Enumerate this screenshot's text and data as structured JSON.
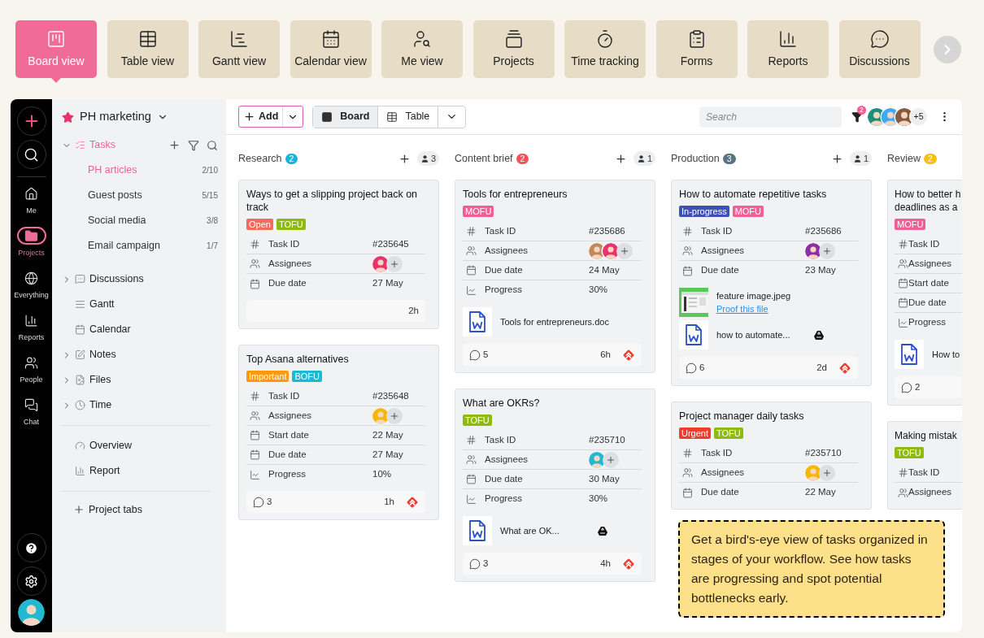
{
  "feature_tabs": [
    {
      "label": "Board view",
      "selected": true
    },
    {
      "label": "Table view",
      "selected": false
    },
    {
      "label": "Gantt view",
      "selected": false
    },
    {
      "label": "Calendar view",
      "selected": false
    },
    {
      "label": "Me view",
      "selected": false
    },
    {
      "label": "Projects",
      "selected": false
    },
    {
      "label": "Time tracking",
      "selected": false
    },
    {
      "label": "Forms",
      "selected": false
    },
    {
      "label": "Reports",
      "selected": false
    },
    {
      "label": "Discussions",
      "selected": false
    }
  ],
  "rail": {
    "items": [
      {
        "label": "Me",
        "selected": false
      },
      {
        "label": "Projects",
        "selected": true
      },
      {
        "label": "Everything",
        "selected": false
      },
      {
        "label": "Reports",
        "selected": false
      },
      {
        "label": "People",
        "selected": false
      },
      {
        "label": "Chat",
        "selected": false
      }
    ],
    "user_avatar": {
      "color": "#22b8cf"
    }
  },
  "sidebar": {
    "project": "PH marketing",
    "groups": [
      [
        {
          "label": "Tasks",
          "kind": "folder",
          "expanded": true,
          "selected": true,
          "children": [
            {
              "label": "PH articles",
              "count": "2/10",
              "selected": true
            },
            {
              "label": "Guest posts",
              "count": "5/15",
              "selected": false
            },
            {
              "label": "Social media",
              "count": "3/8",
              "selected": false
            },
            {
              "label": "Email campaign",
              "count": "1/7",
              "selected": false
            }
          ]
        },
        {
          "label": "Discussions",
          "kind": "folder",
          "expanded": false,
          "selected": false
        },
        {
          "label": "Gantt",
          "kind": "page",
          "selected": false
        },
        {
          "label": "Calendar",
          "kind": "page",
          "selected": false
        },
        {
          "label": "Notes",
          "kind": "folder",
          "expanded": false,
          "selected": false
        },
        {
          "label": "Files",
          "kind": "folder",
          "expanded": false,
          "selected": false
        },
        {
          "label": "Time",
          "kind": "folder",
          "expanded": false,
          "selected": false
        }
      ],
      [
        {
          "label": "Overview",
          "kind": "page",
          "selected": false
        },
        {
          "label": "Report",
          "kind": "page",
          "selected": false
        }
      ]
    ],
    "add_tab": "Project tabs"
  },
  "toolbar": {
    "add": "Add",
    "views": [
      {
        "label": "Board",
        "selected": true
      },
      {
        "label": "Table",
        "selected": false
      }
    ],
    "search_placeholder": "Search",
    "filter_count": "2",
    "members": [
      {
        "color": "#1e8f7a"
      },
      {
        "color": "#3fa9f5"
      },
      {
        "color": "#8a5a3c"
      }
    ],
    "more_members": "+5"
  },
  "columns": [
    {
      "name": "Research",
      "count": "2",
      "color": "#18b4d8",
      "people": "3",
      "cards": [
        {
          "title": "Ways to get a slipping project back on track",
          "tags": [
            {
              "label": "Open",
              "color": "#f26b5b"
            },
            {
              "label": "TOFU",
              "color": "#8fba0f"
            }
          ],
          "fields": [
            {
              "kind": "id",
              "label": "Task ID",
              "value": "#235645"
            },
            {
              "kind": "assignees",
              "label": "Assignees",
              "avatars": [
                {
                  "color": "#e8336d"
                }
              ]
            },
            {
              "kind": "date",
              "label": "Due date",
              "value": "27 May"
            }
          ],
          "footer": {
            "time": "2h",
            "priority": false
          }
        },
        {
          "title": "Top Asana alternatives",
          "tags": [
            {
              "label": "Important",
              "color": "#ff9a0e"
            },
            {
              "label": "BOFU",
              "color": "#1cb8d8"
            }
          ],
          "fields": [
            {
              "kind": "id",
              "label": "Task ID",
              "value": "#235648"
            },
            {
              "kind": "assignees",
              "label": "Assignees",
              "avatars": [
                {
                  "color": "#f5b700"
                }
              ]
            },
            {
              "kind": "date",
              "label": "Start date",
              "value": "22 May"
            },
            {
              "kind": "date",
              "label": "Due date",
              "value": "27 May"
            },
            {
              "kind": "progress",
              "label": "Progress",
              "value": "10%"
            }
          ],
          "footer": {
            "comments": "3",
            "time": "1h",
            "priority": true
          }
        }
      ]
    },
    {
      "name": "Content brief",
      "count": "2",
      "color": "#f2545b",
      "people": "1",
      "cards": [
        {
          "title": "Tools for entrepreneurs",
          "tags": [
            {
              "label": "MOFU",
              "color": "#ef5f94"
            }
          ],
          "fields": [
            {
              "kind": "id",
              "label": "Task ID",
              "value": "#235686"
            },
            {
              "kind": "assignees",
              "label": "Assignees",
              "avatars": [
                {
                  "color": "#c08a5a"
                },
                {
                  "color": "#e8336d"
                }
              ]
            },
            {
              "kind": "date",
              "label": "Due date",
              "value": "24 May"
            },
            {
              "kind": "progress",
              "label": "Progress",
              "value": "30%"
            }
          ],
          "attachments": [
            {
              "kind": "doc",
              "name": "Tools for entrepreneurs.doc",
              "cloud": false
            }
          ],
          "footer": {
            "comments": "5",
            "time": "6h",
            "priority": true
          }
        },
        {
          "title": "What are OKRs?",
          "tags": [
            {
              "label": "TOFU",
              "color": "#8fba0f"
            }
          ],
          "fields": [
            {
              "kind": "id",
              "label": "Task ID",
              "value": "#235710"
            },
            {
              "kind": "assignees",
              "label": "Assignees",
              "avatars": [
                {
                  "color": "#22b8cf"
                }
              ]
            },
            {
              "kind": "date",
              "label": "Due date",
              "value": "30 May"
            },
            {
              "kind": "progress",
              "label": "Progress",
              "value": "30%"
            }
          ],
          "attachments": [
            {
              "kind": "doc",
              "name": "What are OK...",
              "cloud": true
            }
          ],
          "footer": {
            "comments": "3",
            "time": "4h",
            "priority": true
          }
        }
      ]
    },
    {
      "name": "Production",
      "count": "3",
      "color": "#5a7384",
      "people": "1",
      "cards": [
        {
          "title": "How to automate repetitive tasks",
          "tags": [
            {
              "label": "In-progress",
              "color": "#3f51b5"
            },
            {
              "label": "MOFU",
              "color": "#ef5f94"
            }
          ],
          "fields": [
            {
              "kind": "id",
              "label": "Task ID",
              "value": "#235686"
            },
            {
              "kind": "assignees",
              "label": "Assignees",
              "avatars": [
                {
                  "color": "#8e2fa8"
                }
              ]
            },
            {
              "kind": "date",
              "label": "Due date",
              "value": "23 May"
            }
          ],
          "attachments": [
            {
              "name": "feature image.jpeg",
              "link": "Proof this file"
            },
            {
              "kind": "doc",
              "name": "how to automate...",
              "cloud": true
            }
          ],
          "footer": {
            "comments": "6",
            "time": "2d",
            "priority": true
          }
        },
        {
          "title": "Project manager daily tasks",
          "tags": [
            {
              "label": "Urgent",
              "color": "#f23b2f"
            },
            {
              "label": "TOFU",
              "color": "#8fba0f"
            }
          ],
          "fields": [
            {
              "kind": "id",
              "label": "Task ID",
              "value": "#235710"
            },
            {
              "kind": "assignees",
              "label": "Assignees",
              "avatars": [
                {
                  "color": "#f5b700"
                }
              ]
            },
            {
              "kind": "date",
              "label": "Due date",
              "value": "22 May"
            }
          ]
        }
      ]
    },
    {
      "name": "Review",
      "count": "2",
      "color": "#f7bf18",
      "cards": [
        {
          "title": "How to better h deadlines as a",
          "tags": [
            {
              "label": "MOFU",
              "color": "#ef5f94"
            }
          ],
          "fields": [
            {
              "kind": "id",
              "label": "Task ID"
            },
            {
              "kind": "assignees",
              "label": "Assignees"
            },
            {
              "kind": "date",
              "label": "Start date"
            },
            {
              "kind": "date",
              "label": "Due date"
            },
            {
              "kind": "progress",
              "label": "Progress"
            }
          ],
          "attachments": [
            {
              "kind": "doc",
              "name": "How to",
              "cloud": false
            }
          ],
          "footer": {
            "comments": "2",
            "priority": false
          }
        },
        {
          "title": "Making mistak",
          "tags": [
            {
              "label": "TOFU",
              "color": "#8fba0f"
            }
          ],
          "fields": [
            {
              "kind": "id",
              "label": "Task ID"
            },
            {
              "kind": "assignees",
              "label": "Assignees"
            }
          ]
        }
      ]
    }
  ],
  "tooltip": "Get a bird's-eye view of tasks organized in stages of your workflow. See how tasks are progressing and spot potential bottlenecks early."
}
